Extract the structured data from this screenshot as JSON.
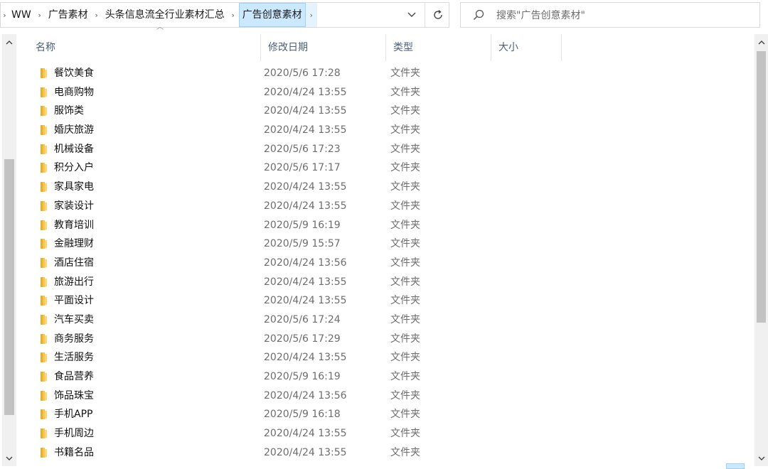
{
  "address_bar": {
    "crumbs": [
      "WW",
      "广告素材",
      "头条信息流全行业素材汇总",
      "广告创意素材"
    ]
  },
  "search": {
    "placeholder": "搜索\"广告创意素材\""
  },
  "columns": {
    "name": "名称",
    "date": "修改日期",
    "type": "类型",
    "size": "大小"
  },
  "colors": {
    "accent": "#cce8ff",
    "folder": "#f7c44f"
  },
  "files": [
    {
      "name": "餐饮美食",
      "date": "2020/5/6 17:28",
      "type": "文件夹"
    },
    {
      "name": "电商购物",
      "date": "2020/4/24 13:55",
      "type": "文件夹"
    },
    {
      "name": "服饰类",
      "date": "2020/4/24 13:55",
      "type": "文件夹"
    },
    {
      "name": "婚庆旅游",
      "date": "2020/4/24 13:55",
      "type": "文件夹"
    },
    {
      "name": "机械设备",
      "date": "2020/5/6 17:23",
      "type": "文件夹"
    },
    {
      "name": "积分入户",
      "date": "2020/5/6 17:17",
      "type": "文件夹"
    },
    {
      "name": "家具家电",
      "date": "2020/4/24 13:55",
      "type": "文件夹"
    },
    {
      "name": "家装设计",
      "date": "2020/4/24 13:55",
      "type": "文件夹"
    },
    {
      "name": "教育培训",
      "date": "2020/5/9 16:19",
      "type": "文件夹"
    },
    {
      "name": "金融理财",
      "date": "2020/5/9 15:57",
      "type": "文件夹"
    },
    {
      "name": "酒店住宿",
      "date": "2020/4/24 13:56",
      "type": "文件夹"
    },
    {
      "name": "旅游出行",
      "date": "2020/4/24 13:55",
      "type": "文件夹"
    },
    {
      "name": "平面设计",
      "date": "2020/4/24 13:55",
      "type": "文件夹"
    },
    {
      "name": "汽车买卖",
      "date": "2020/5/6 17:24",
      "type": "文件夹"
    },
    {
      "name": "商务服务",
      "date": "2020/5/6 17:29",
      "type": "文件夹"
    },
    {
      "name": "生活服务",
      "date": "2020/4/24 13:55",
      "type": "文件夹"
    },
    {
      "name": "食品营养",
      "date": "2020/5/9 16:19",
      "type": "文件夹"
    },
    {
      "name": "饰品珠宝",
      "date": "2020/4/24 13:56",
      "type": "文件夹"
    },
    {
      "name": "手机APP",
      "date": "2020/5/9 16:18",
      "type": "文件夹"
    },
    {
      "name": "手机周边",
      "date": "2020/4/24 13:55",
      "type": "文件夹"
    },
    {
      "name": "书籍名品",
      "date": "2020/4/24 13:55",
      "type": "文件夹"
    }
  ]
}
